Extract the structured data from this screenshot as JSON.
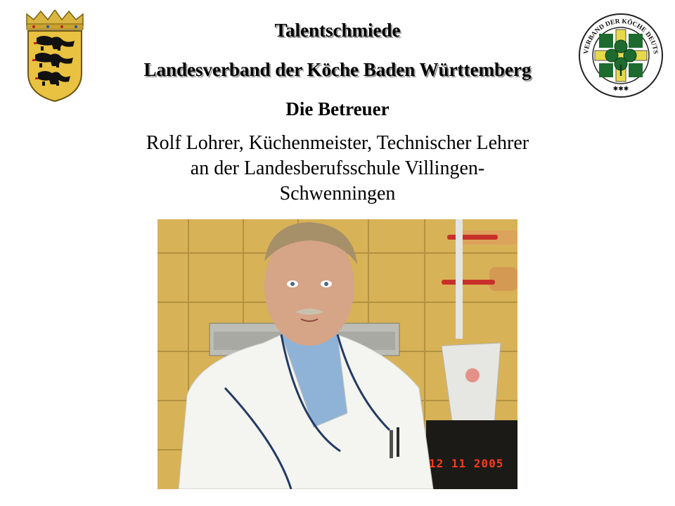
{
  "header": {
    "title": "Talentschmiede",
    "subtitle": "Landesverband der Köche Baden Württemberg"
  },
  "section": {
    "heading": "Die Betreuer"
  },
  "person": {
    "description_lines": [
      "Rolf Lohrer, Küchenmeister, Technischer Lehrer",
      "an der Landesberufsschule Villingen-",
      "Schwenningen"
    ]
  },
  "logos": {
    "left": "coat-of-arms-baden-wuerttemberg",
    "right": "seal-verband-der-koeche-deutschlands",
    "right_seal_text": "VERBAND DER KÖCHE DEUTSCHLANDS e.V."
  },
  "photo": {
    "date_stamp": "12 11 2005"
  },
  "colors": {
    "text": "#000000",
    "shadow": "#9a9a9a",
    "tile": "#d8b257",
    "seal_green": "#1e6b2f",
    "seal_yellow": "#e8d94a",
    "date_stamp": "#ff3a1a"
  }
}
